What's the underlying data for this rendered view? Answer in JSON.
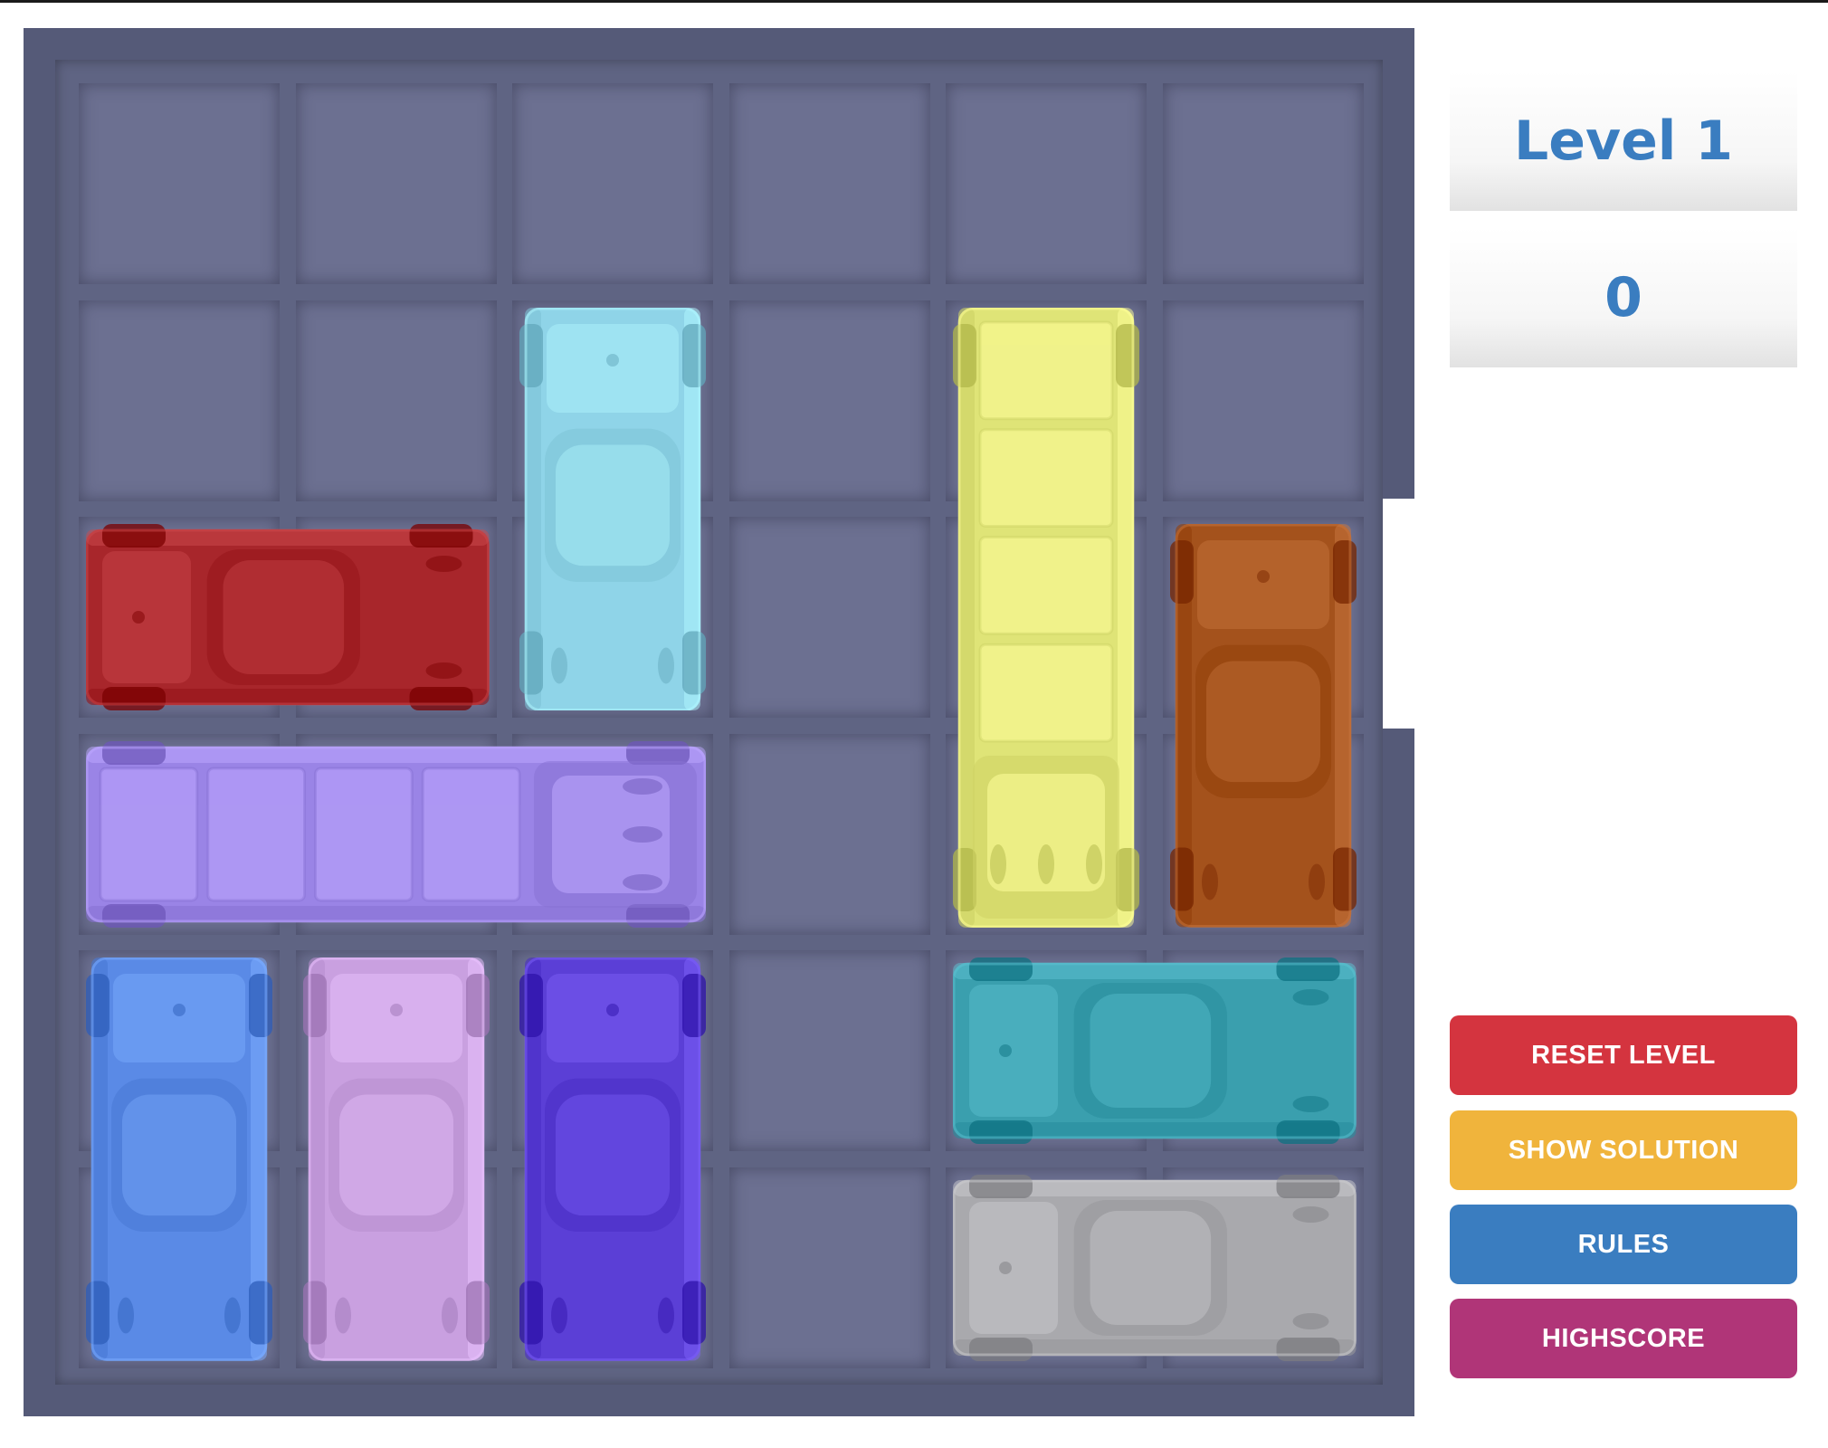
{
  "game": {
    "level_label": "Level 1",
    "moves": "0",
    "grid": {
      "rows": 6,
      "cols": 6
    },
    "exit": {
      "row": 3,
      "side": "right"
    },
    "cars": [
      {
        "id": "red",
        "color": "#a8262b",
        "row": 3,
        "col": 1,
        "length": 2,
        "orientation": "horizontal",
        "kind": "car"
      },
      {
        "id": "light-blue",
        "color": "#8fd4e8",
        "row": 2,
        "col": 3,
        "length": 2,
        "orientation": "vertical",
        "kind": "car"
      },
      {
        "id": "yellow",
        "color": "#dfe477",
        "row": 2,
        "col": 5,
        "length": 3,
        "orientation": "vertical",
        "kind": "truck"
      },
      {
        "id": "orange",
        "color": "#a4521c",
        "row": 3,
        "col": 6,
        "length": 2,
        "orientation": "vertical",
        "kind": "car"
      },
      {
        "id": "purple",
        "color": "#9a84e6",
        "row": 4,
        "col": 1,
        "length": 3,
        "orientation": "horizontal",
        "kind": "truck"
      },
      {
        "id": "blue",
        "color": "#5a8ae6",
        "row": 5,
        "col": 1,
        "length": 2,
        "orientation": "vertical",
        "kind": "car"
      },
      {
        "id": "lilac",
        "color": "#c9a0e0",
        "row": 5,
        "col": 2,
        "length": 2,
        "orientation": "vertical",
        "kind": "car"
      },
      {
        "id": "indigo",
        "color": "#5b3fd6",
        "row": 5,
        "col": 3,
        "length": 2,
        "orientation": "vertical",
        "kind": "car"
      },
      {
        "id": "teal",
        "color": "#3a9fae",
        "row": 5,
        "col": 5,
        "length": 2,
        "orientation": "horizontal",
        "kind": "car"
      },
      {
        "id": "gray",
        "color": "#a9a9ad",
        "row": 6,
        "col": 5,
        "length": 2,
        "orientation": "horizontal",
        "kind": "car"
      }
    ]
  },
  "buttons": {
    "reset": {
      "label": "RESET LEVEL",
      "color": "#d4343f"
    },
    "solution": {
      "label": "SHOW SOLUTION",
      "color": "#f0b43c"
    },
    "rules": {
      "label": "RULES",
      "color": "#3a7dc0"
    },
    "highscore": {
      "label": "HIGHSCORE",
      "color": "#b03578"
    }
  },
  "colors": {
    "board_frame": "#555a78",
    "cell": "#6c7091",
    "panel_text": "#3a7dc0"
  }
}
